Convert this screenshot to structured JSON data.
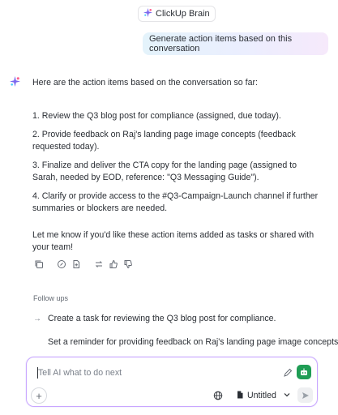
{
  "header": {
    "brand_label": "ClickUp Brain"
  },
  "conversation": {
    "user_message": "Generate action items based on this conversation",
    "assistant": {
      "intro": "Here are the action items based on the conversation so far:",
      "items": [
        "1.  Review the Q3 blog post for compliance (assigned, due today).",
        "2.  Provide feedback on Raj's landing page image concepts (feedback requested today).",
        "3.  Finalize and deliver the CTA copy for the landing page (assigned to Sarah, needed by EOD, reference: \"Q3 Messaging Guide\").",
        "4.  Clarify or provide access to the #Q3-Campaign-Launch channel if further summaries or blockers are needed."
      ],
      "outro": "Let me know if you'd like these action items added as tasks or shared with your team!"
    }
  },
  "followups": {
    "label": "Follow ups",
    "items": [
      "Create a task for reviewing the Q3 blog post for compliance.",
      "Set a reminder for providing feedback on Raj's landing page image concepts"
    ]
  },
  "composer": {
    "placeholder": "Tell AI what to do next",
    "doc_label": "Untitled"
  },
  "colors": {
    "accent": "#7b68ee",
    "bot_green": "#1f9d55"
  }
}
